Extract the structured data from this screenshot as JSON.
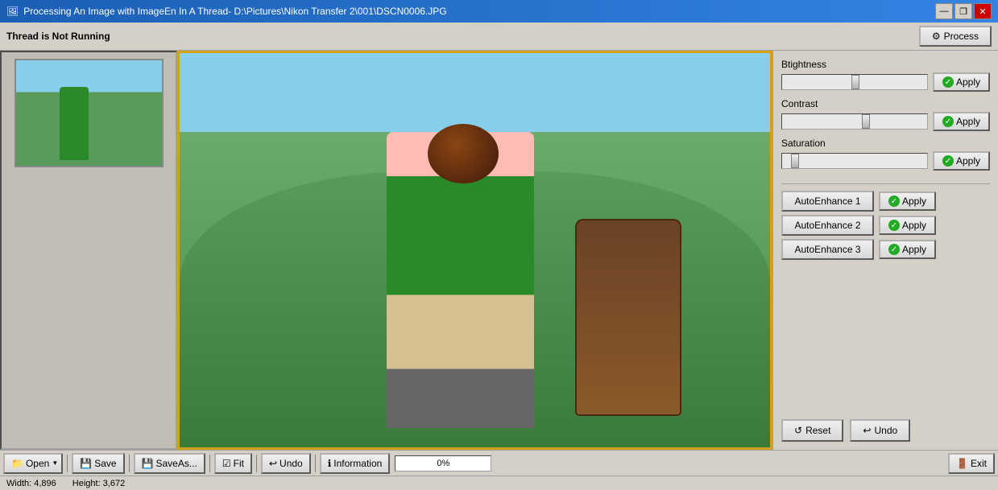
{
  "window": {
    "title": "Processing An Image with ImageEn In A Thread- D:\\Pictures\\Nikon Transfer 2\\001\\DSCN0006.JPG",
    "app_icon": "image-icon"
  },
  "titlebar": {
    "minimize_label": "—",
    "restore_label": "❐",
    "close_label": "✕"
  },
  "topbar": {
    "thread_status": "Thread is Not Running",
    "process_button": "Process"
  },
  "right_panel": {
    "brightness_label": "Btightness",
    "contrast_label": "Contrast",
    "saturation_label": "Saturation",
    "apply_label": "Apply",
    "autoenh1_label": "AutoEnhance 1",
    "autoenh2_label": "AutoEnhance 2",
    "autoenh3_label": "AutoEnhance 3",
    "reset_label": "Reset",
    "undo_label": "Undo"
  },
  "bottom_toolbar": {
    "open_label": "Open",
    "save_label": "Save",
    "saveas_label": "SaveAs...",
    "fit_label": "Fit",
    "undo_label": "Undo",
    "information_label": "Information",
    "progress_value": "0%",
    "exit_label": "Exit"
  },
  "status_bar": {
    "width_label": "Width: 4,896",
    "height_label": "Height: 3,672"
  }
}
